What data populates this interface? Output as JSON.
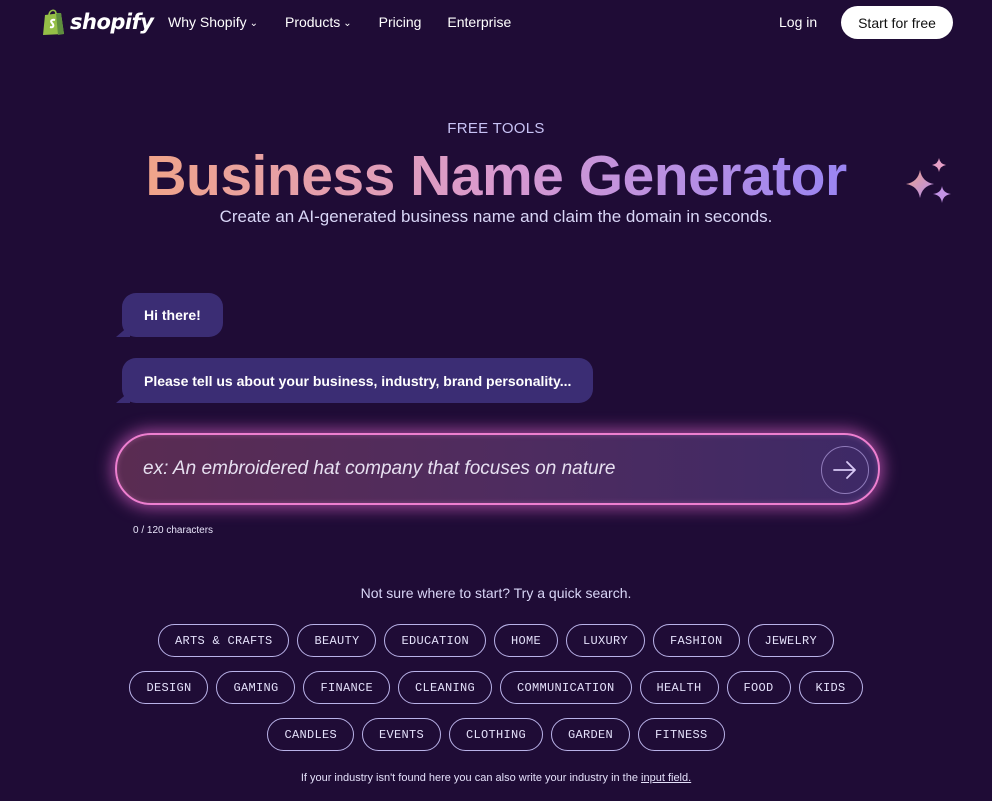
{
  "header": {
    "logo_text": "shopify",
    "nav": [
      {
        "label": "Why Shopify",
        "dropdown": true
      },
      {
        "label": "Products",
        "dropdown": true
      },
      {
        "label": "Pricing",
        "dropdown": false
      },
      {
        "label": "Enterprise",
        "dropdown": false
      }
    ],
    "login_label": "Log in",
    "start_label": "Start for free"
  },
  "hero": {
    "eyebrow": "FREE TOOLS",
    "title": "Business Name Generator",
    "subtitle": "Create an AI-generated business name and claim the domain in seconds."
  },
  "chat": {
    "messages": [
      "Hi there!",
      "Please tell us about your business, industry, brand personality..."
    ]
  },
  "input": {
    "placeholder": "ex: An embroidered hat company that focuses on nature",
    "value": "",
    "char_count": "0 / 120 characters"
  },
  "quick_search": {
    "title": "Not sure where to start? Try a quick search.",
    "rows": [
      [
        "ARTS & CRAFTS",
        "BEAUTY",
        "EDUCATION",
        "HOME",
        "LUXURY",
        "FASHION",
        "JEWELRY"
      ],
      [
        "DESIGN",
        "GAMING",
        "FINANCE",
        "CLEANING",
        "COMMUNICATION",
        "HEALTH",
        "FOOD",
        "KIDS"
      ],
      [
        "CANDLES",
        "EVENTS",
        "CLOTHING",
        "GARDEN",
        "FITNESS"
      ]
    ]
  },
  "footnote": {
    "text": "If your industry isn't found here you can also write your industry in the ",
    "link": "input field."
  },
  "colors": {
    "background": "#1f0c36",
    "bubble": "#3b2d74",
    "input_border": "#ee7fd0",
    "logo_green": "#95bf47"
  }
}
